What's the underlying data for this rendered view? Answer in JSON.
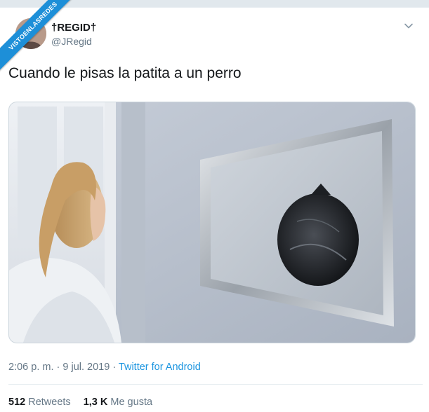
{
  "watermark": {
    "text": "VISTOENLASREDES"
  },
  "author": {
    "display_name": "†REGID†",
    "handle": "@JRegid"
  },
  "icons": {
    "menu": "chevron-down-icon"
  },
  "tweet": {
    "text": "Cuando le pisas la patita a un perro",
    "media_description": "photo"
  },
  "meta": {
    "time": "2:06 p. m.",
    "sep1": " · ",
    "date": "9 jul. 2019",
    "sep2": " · ",
    "source": "Twitter for Android"
  },
  "stats": {
    "retweets_count": "512",
    "retweets_label": "Retweets",
    "likes_count": "1,3 K",
    "likes_label": "Me gusta"
  },
  "colors": {
    "link": "#1b95e0",
    "text": "#14171a",
    "secondary": "#657786",
    "ribbon": "#1d8fd8"
  }
}
